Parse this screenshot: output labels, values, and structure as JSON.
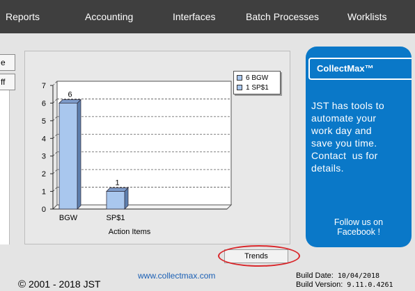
{
  "nav": {
    "items": [
      {
        "label": "Reports"
      },
      {
        "label": "Accounting"
      },
      {
        "label": "Interfaces"
      },
      {
        "label": "Batch Processes"
      },
      {
        "label": "Worklists"
      }
    ]
  },
  "side_buttons": [
    {
      "label": "e"
    },
    {
      "label": "ff"
    }
  ],
  "chart_data": {
    "type": "bar",
    "categories": [
      "BGW",
      "SP$1"
    ],
    "values": [
      6,
      1
    ],
    "data_labels": [
      "6",
      "1"
    ],
    "xlabel": "Action Items",
    "ylabel": "",
    "ylim": [
      0,
      7
    ],
    "yticks": [
      "0",
      "1",
      "2",
      "3",
      "4",
      "5",
      "6",
      "7"
    ],
    "legend": [
      "6 BGW",
      "1 SP$1"
    ],
    "legend_position": "top-right",
    "grid": true,
    "bar_color": "#a9c7ee",
    "style": "3d"
  },
  "collectmax": {
    "title": "CollectMax™",
    "body_lines": [
      "JST has tools to",
      "automate your",
      "work day and",
      "save you time.",
      "Contact  us for",
      "details."
    ],
    "follow_lines": [
      "Follow us on",
      "Facebook !"
    ]
  },
  "trends": {
    "label": "Trends"
  },
  "footer": {
    "copyright_icon": "©",
    "copyright_text": "2001 - 2018 JST",
    "link": "www.collectmax.com",
    "build_date_label": "Build Date:",
    "build_date": "10/04/2018",
    "build_version_label": "Build Version:",
    "build_version": "9.11.0.4261"
  },
  "colors": {
    "nav_bg": "#3f3f3f",
    "content_bg": "#e4e4e4",
    "brand_blue": "#0a78c8",
    "highlight_ring": "#d9262a",
    "link": "#1a5fb4"
  }
}
